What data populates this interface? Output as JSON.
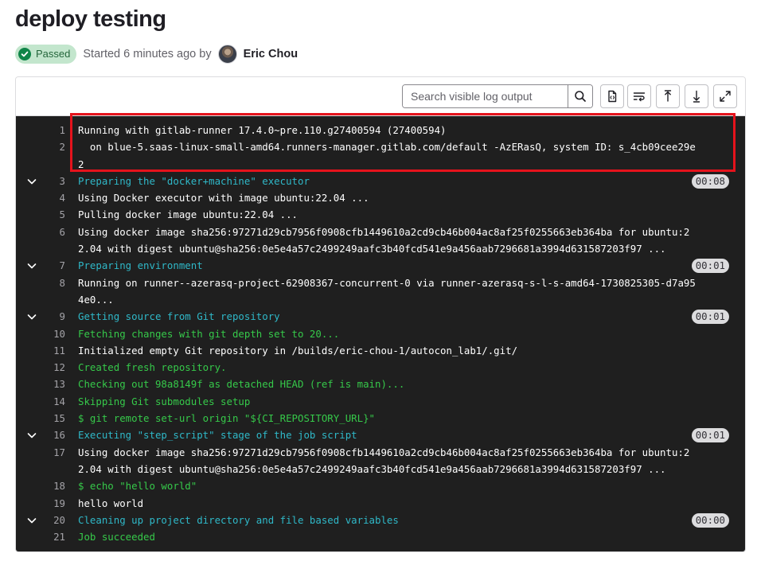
{
  "page": {
    "title": "deploy testing",
    "status_label": "Passed",
    "started_text": "Started 6 minutes ago by",
    "author": "Eric Chou"
  },
  "toolbar": {
    "search_placeholder": "Search visible log output",
    "icons": [
      "search-icon",
      "raw-log-icon",
      "wrap-lines-icon",
      "scroll-to-top-icon",
      "scroll-to-bottom-icon",
      "fullscreen-icon"
    ]
  },
  "colors": {
    "log_background": "#1f1f1f",
    "section_header": "#2fb8c8",
    "success_text": "#36c94a",
    "highlight_box": "#e5131c",
    "badge_bg": "#c3e6cd",
    "badge_icon": "#108548"
  },
  "log_lines": [
    {
      "n": "1",
      "text": "Running with gitlab-runner 17.4.0~pre.110.g27400594 (27400594)",
      "color": "white"
    },
    {
      "n": "2",
      "text": "  on blue-5.saas-linux-small-amd64.runners-manager.gitlab.com/default -AzERasQ, system ID: s_4cb09cee29e",
      "color": "white"
    },
    {
      "n": "",
      "text": "2",
      "color": "white"
    },
    {
      "n": "3",
      "text": "Preparing the \"docker+machine\" executor",
      "color": "cyan",
      "collapsible": true,
      "duration": "00:08"
    },
    {
      "n": "4",
      "text": "Using Docker executor with image ubuntu:22.04 ...",
      "color": "white"
    },
    {
      "n": "5",
      "text": "Pulling docker image ubuntu:22.04 ...",
      "color": "white"
    },
    {
      "n": "6",
      "text": "Using docker image sha256:97271d29cb7956f0908cfb1449610a2cd9cb46b004ac8af25f0255663eb364ba for ubuntu:2",
      "color": "white"
    },
    {
      "n": "",
      "text": "2.04 with digest ubuntu@sha256:0e5e4a57c2499249aafc3b40fcd541e9a456aab7296681a3994d631587203f97 ...",
      "color": "white"
    },
    {
      "n": "7",
      "text": "Preparing environment",
      "color": "cyan",
      "collapsible": true,
      "duration": "00:01"
    },
    {
      "n": "8",
      "text": "Running on runner--azerasq-project-62908367-concurrent-0 via runner-azerasq-s-l-s-amd64-1730825305-d7a95",
      "color": "white"
    },
    {
      "n": "",
      "text": "4e0...",
      "color": "white"
    },
    {
      "n": "9",
      "text": "Getting source from Git repository",
      "color": "cyan",
      "collapsible": true,
      "duration": "00:01"
    },
    {
      "n": "10",
      "text": "Fetching changes with git depth set to 20...",
      "color": "green"
    },
    {
      "n": "11",
      "text": "Initialized empty Git repository in /builds/eric-chou-1/autocon_lab1/.git/",
      "color": "white"
    },
    {
      "n": "12",
      "text": "Created fresh repository.",
      "color": "green"
    },
    {
      "n": "13",
      "text": "Checking out 98a8149f as detached HEAD (ref is main)...",
      "color": "green"
    },
    {
      "n": "14",
      "text": "Skipping Git submodules setup",
      "color": "green"
    },
    {
      "n": "15",
      "text": "$ git remote set-url origin \"${CI_REPOSITORY_URL}\"",
      "color": "green"
    },
    {
      "n": "16",
      "text": "Executing \"step_script\" stage of the job script",
      "color": "cyan",
      "collapsible": true,
      "duration": "00:01"
    },
    {
      "n": "17",
      "text": "Using docker image sha256:97271d29cb7956f0908cfb1449610a2cd9cb46b004ac8af25f0255663eb364ba for ubuntu:2",
      "color": "white"
    },
    {
      "n": "",
      "text": "2.04 with digest ubuntu@sha256:0e5e4a57c2499249aafc3b40fcd541e9a456aab7296681a3994d631587203f97 ...",
      "color": "white"
    },
    {
      "n": "18",
      "text": "$ echo \"hello world\"",
      "color": "green"
    },
    {
      "n": "19",
      "text": "hello world",
      "color": "white"
    },
    {
      "n": "20",
      "text": "Cleaning up project directory and file based variables",
      "color": "cyan",
      "collapsible": true,
      "duration": "00:00"
    },
    {
      "n": "21",
      "text": "Job succeeded",
      "color": "green"
    }
  ]
}
